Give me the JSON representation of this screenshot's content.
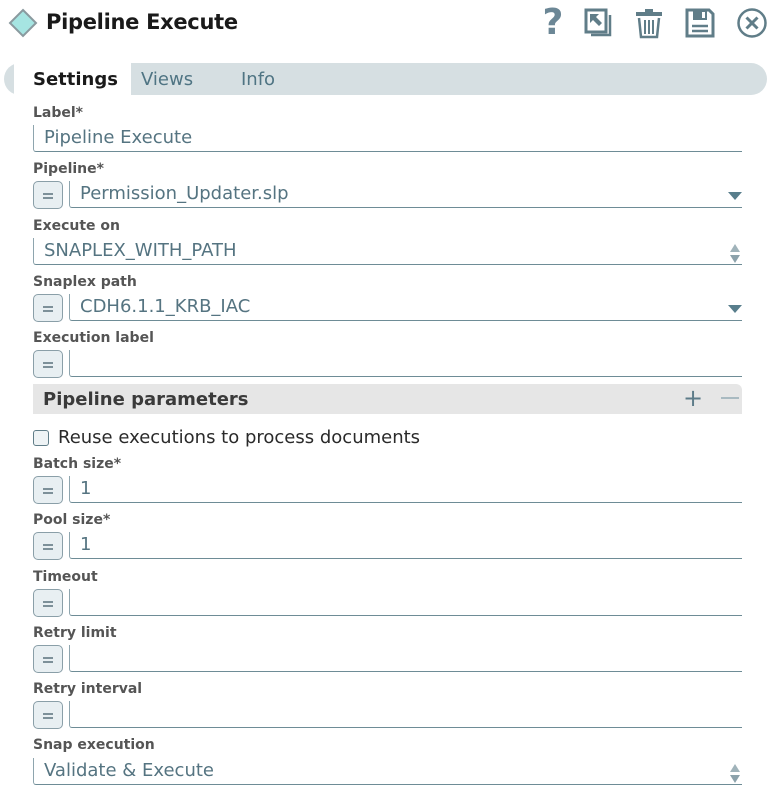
{
  "header": {
    "title": "Pipeline Execute",
    "snap_icon": "diamond-icon",
    "help_label": "?",
    "actions": [
      "help-icon",
      "export-icon",
      "delete-icon",
      "save-icon",
      "close-icon"
    ]
  },
  "tabs": [
    {
      "label": "Settings",
      "active": true
    },
    {
      "label": "Views",
      "active": false
    },
    {
      "label": "Info",
      "active": false
    }
  ],
  "fields": {
    "label": {
      "label": "Label*",
      "value": "Pipeline Execute"
    },
    "pipeline": {
      "label": "Pipeline*",
      "value": "Permission_Updater.slp"
    },
    "execute_on": {
      "label": "Execute on",
      "value": "SNAPLEX_WITH_PATH"
    },
    "snaplex_path": {
      "label": "Snaplex path",
      "value": "CDH6.1.1_KRB_IAC"
    },
    "execution_label": {
      "label": "Execution label",
      "value": ""
    },
    "pipeline_parameters": {
      "title": "Pipeline parameters",
      "add": "+",
      "remove": "−"
    },
    "reuse_executions": {
      "label": "Reuse executions to process documents",
      "checked": false
    },
    "batch_size": {
      "label": "Batch size*",
      "value": "1"
    },
    "pool_size": {
      "label": "Pool size*",
      "value": "1"
    },
    "timeout": {
      "label": "Timeout",
      "value": ""
    },
    "retry_limit": {
      "label": "Retry limit",
      "value": ""
    },
    "retry_interval": {
      "label": "Retry interval",
      "value": ""
    },
    "snap_execution": {
      "label": "Snap execution",
      "value": "Validate & Execute"
    }
  },
  "colors": {
    "accent": "#587e8c",
    "tab_bar": "#d6dfe2",
    "diamond_fill": "#a6e5e2",
    "section_bg": "#e6e6e6"
  }
}
